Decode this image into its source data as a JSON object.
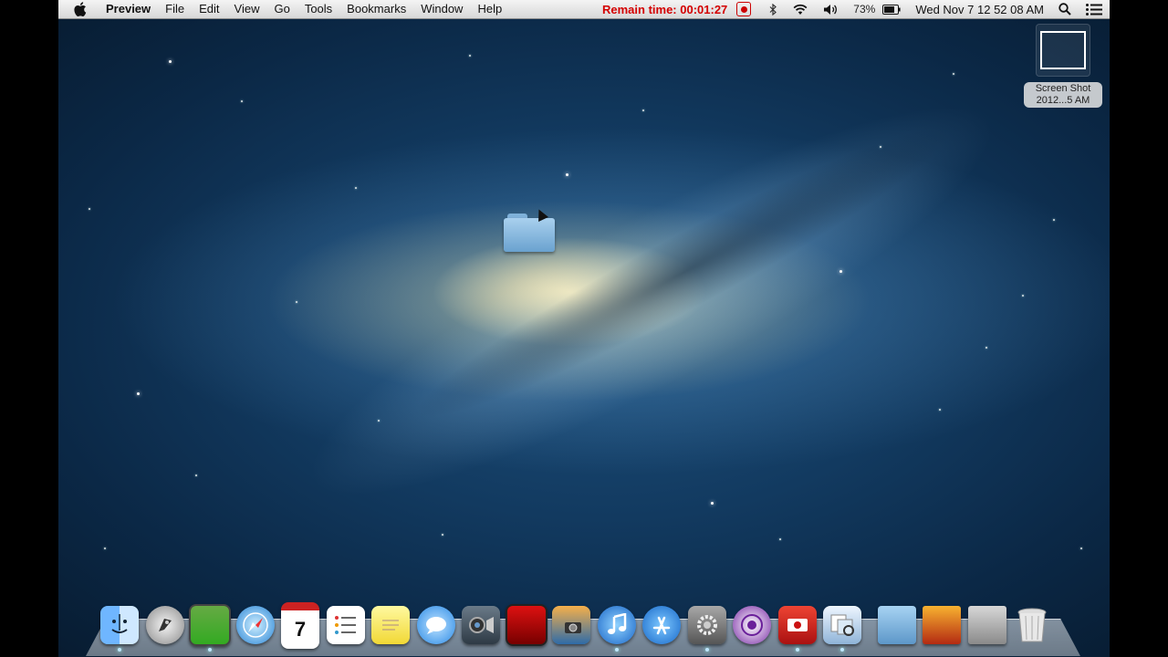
{
  "menubar": {
    "app_name": "Preview",
    "menus": [
      "File",
      "Edit",
      "View",
      "Go",
      "Tools",
      "Bookmarks",
      "Window",
      "Help"
    ],
    "remain_time": "Remain time: 00:01:27",
    "battery": "73%",
    "clock": "Wed Nov 7  12 52 08 AM"
  },
  "desktop": {
    "screenshot_file": {
      "line1": "Screen Shot",
      "line2": "2012...5 AM"
    }
  },
  "dock": {
    "items": [
      {
        "icon": "finder-icon"
      },
      {
        "icon": "launchpad-icon"
      },
      {
        "icon": "photo-booth-icon"
      },
      {
        "icon": "safari-icon"
      },
      {
        "icon": "calendar-icon",
        "text": "7"
      },
      {
        "icon": "reminders-icon"
      },
      {
        "icon": "stickies-icon"
      },
      {
        "icon": "messages-icon"
      },
      {
        "icon": "facetime-icon"
      },
      {
        "icon": "photo-booth-icon"
      },
      {
        "icon": "iphoto-icon"
      },
      {
        "icon": "itunes-icon"
      },
      {
        "icon": "app-store-icon"
      },
      {
        "icon": "system-preferences-icon"
      },
      {
        "icon": "bittorrent-icon"
      },
      {
        "icon": "screen-recorder-icon"
      },
      {
        "icon": "preview-icon"
      },
      {
        "icon": "documents-folder-icon"
      },
      {
        "icon": "movie-icon"
      },
      {
        "icon": "downloads-folder-icon"
      },
      {
        "icon": "trash-icon"
      }
    ]
  },
  "colors": {
    "remain_time": "#d40000",
    "folder": "#7fb1d9"
  }
}
